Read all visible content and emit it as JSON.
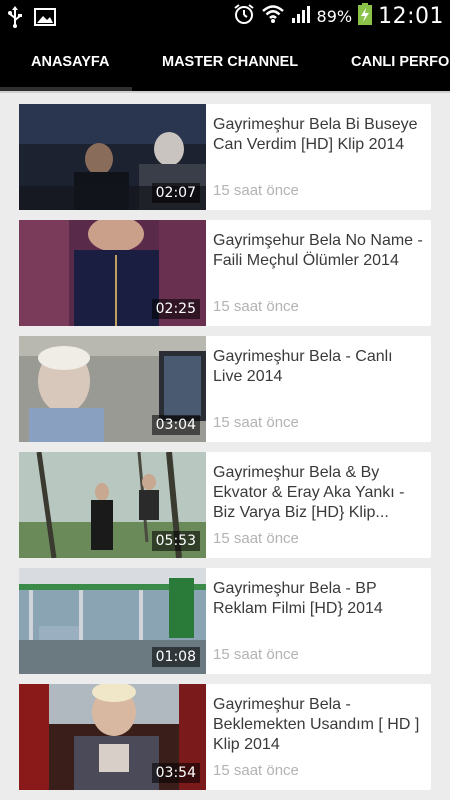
{
  "statusbar": {
    "battery_percent": "89%",
    "time": "12:01",
    "icons": [
      "usb-icon",
      "image-icon",
      "alarm-icon",
      "wifi-icon",
      "signal-icon",
      "battery-charging-icon"
    ]
  },
  "tabs": [
    {
      "label": "ANASAYFA",
      "active": true
    },
    {
      "label": "MASTER CHANNEL",
      "active": false
    },
    {
      "label": "CANLI PERFOR",
      "active": false
    }
  ],
  "videos": [
    {
      "title": "Gayrimeşhur Bela   Bi Buseye Can Verdim [HD] Klip 2014",
      "duration": "02:07",
      "time": "15 saat önce"
    },
    {
      "title": "Gayrimşehur Bela No Name - Faili Meçhul Ölümler 2014",
      "duration": "02:25",
      "time": "15 saat önce"
    },
    {
      "title": "Gayrimeşhur Bela - Canlı Live 2014",
      "duration": "03:04",
      "time": "15 saat önce"
    },
    {
      "title": "Gayrimeşhur Bela & By Ekvator & Eray Aka Yankı - Biz Varya Biz [HD} Klip...",
      "duration": "05:53",
      "time": "15 saat önce"
    },
    {
      "title": "Gayrimeşhur Bela - BP Reklam Filmi [HD} 2014",
      "duration": "01:08",
      "time": "15 saat önce"
    },
    {
      "title": "Gayrimeşhur Bela - Beklemekten Usandım [ HD ] Klip 2014",
      "duration": "03:54",
      "time": "15 saat önce"
    }
  ],
  "colors": {
    "background": "#ececec",
    "bar": "#000000",
    "card": "#ffffff",
    "title_text": "#3a3a3a",
    "meta_text": "#b3b3b3"
  }
}
